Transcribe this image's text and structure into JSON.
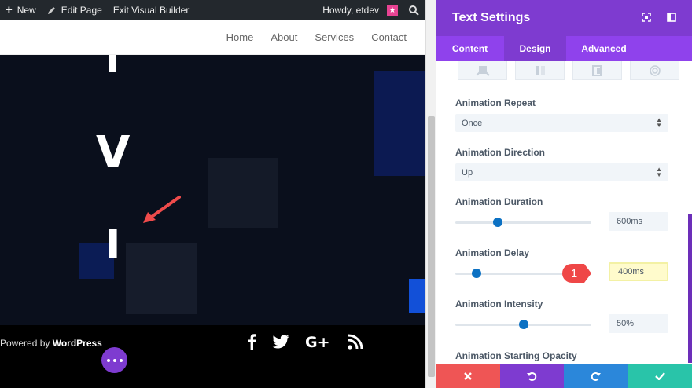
{
  "adminbar": {
    "new_label": "New",
    "edit_label": "Edit Page",
    "exit_label": "Exit Visual Builder",
    "howdy": "Howdy, etdev"
  },
  "nav": [
    "Home",
    "About",
    "Services",
    "Contact"
  ],
  "hero": {
    "chars": [
      "I",
      "V",
      "I"
    ]
  },
  "footer": {
    "powered_prefix": "Powered by ",
    "powered_brand": "WordPress"
  },
  "panel": {
    "title": "Text Settings",
    "tabs": [
      "Content",
      "Design",
      "Advanced"
    ],
    "active_tab": "Design",
    "fields": {
      "repeat": {
        "label": "Animation Repeat",
        "value": "Once"
      },
      "direction": {
        "label": "Animation Direction",
        "value": "Up"
      },
      "duration": {
        "label": "Animation Duration",
        "value": "600ms"
      },
      "delay": {
        "label": "Animation Delay",
        "value": "400ms"
      },
      "intensity": {
        "label": "Animation Intensity",
        "value": "50%"
      },
      "opacity": {
        "label": "Animation Starting Opacity"
      }
    },
    "callout": "1"
  },
  "colors": {
    "accent": "#7e3bd0",
    "tab_bar": "#8f42ec",
    "slider": "#0c71c3",
    "discard": "#ef5555",
    "undo": "#7e3bd0",
    "redo": "#2b87da",
    "save": "#29c4a9"
  }
}
